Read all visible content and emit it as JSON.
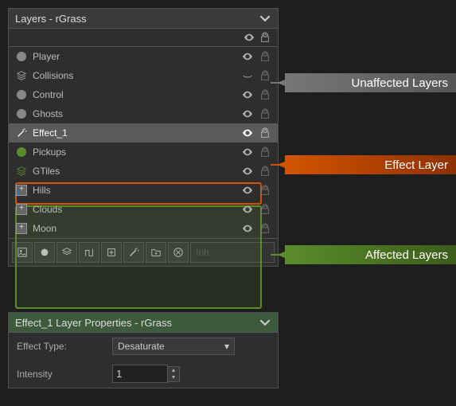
{
  "header": {
    "title": "Layers - rGrass"
  },
  "layers": [
    {
      "name": "Player",
      "type": "circle"
    },
    {
      "name": "Collisions",
      "type": "stack"
    },
    {
      "name": "Control",
      "type": "circle"
    },
    {
      "name": "Ghosts",
      "type": "circle"
    },
    {
      "name": "Effect_1",
      "type": "wand",
      "selected": true
    },
    {
      "name": "Pickups",
      "type": "gcircle"
    },
    {
      "name": "GTiles",
      "type": "gstack"
    },
    {
      "name": "Hills",
      "type": "plus"
    },
    {
      "name": "Clouds",
      "type": "plus"
    },
    {
      "name": "Moon",
      "type": "plus"
    }
  ],
  "toolbar": {
    "placeholder": "Inh"
  },
  "properties": {
    "title": "Effect_1 Layer Properties - rGrass",
    "effect_type_label": "Effect Type:",
    "effect_type_value": "Desaturate",
    "intensity_label": "Intensity",
    "intensity_value": "1"
  },
  "callouts": {
    "unaffected": "Unaffected Layers",
    "effect": "Effect Layer",
    "affected": "Affected Layers"
  }
}
